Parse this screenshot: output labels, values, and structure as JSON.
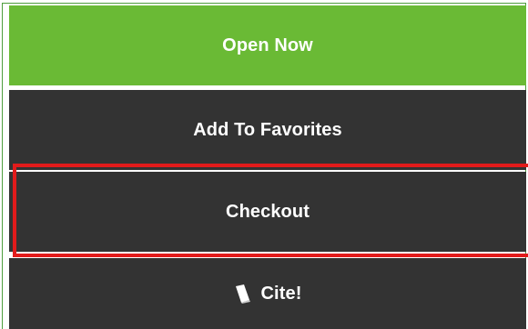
{
  "buttons": {
    "open_now": "Open Now",
    "add_to_favorites": "Add To Favorites",
    "checkout": "Checkout",
    "cite": "Cite!"
  },
  "icons": {
    "cite": "book-icon"
  },
  "colors": {
    "open_now_bg": "#6aba35",
    "dark_button_bg": "#333333",
    "highlight": "#e21b1b",
    "frame_border": "#4d9d3d"
  }
}
